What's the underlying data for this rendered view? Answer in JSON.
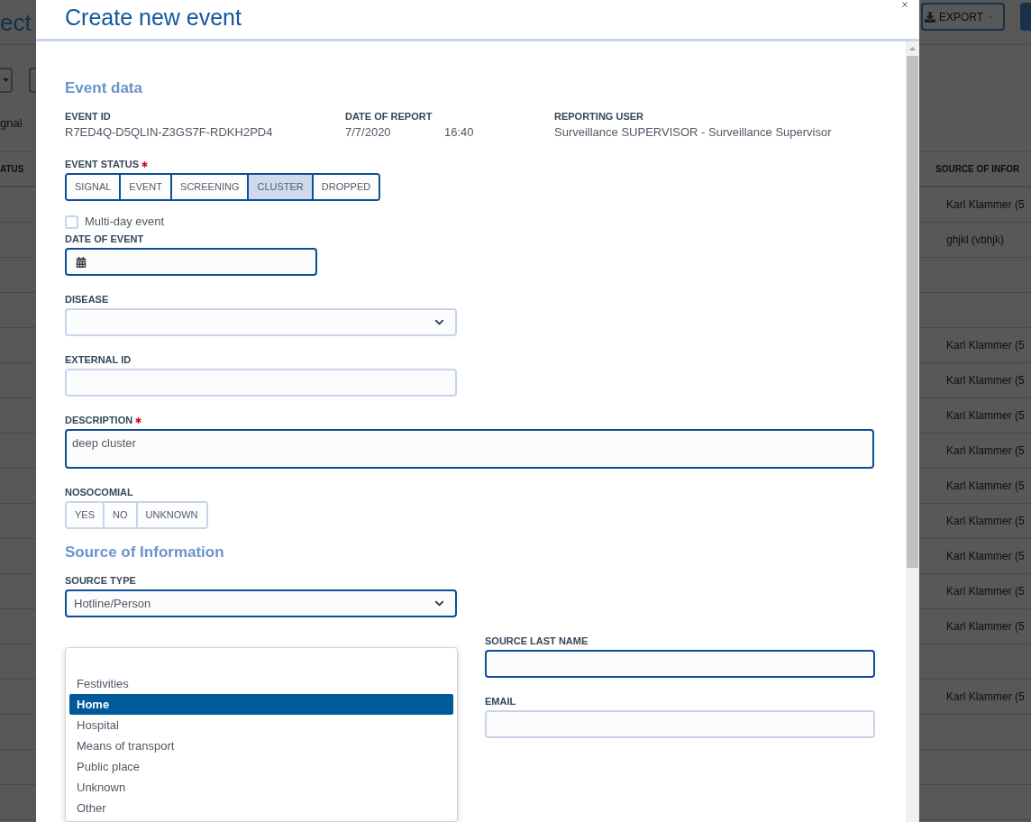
{
  "background": {
    "page_title": "ect",
    "export_button": "EXPORT",
    "tab": "gnal",
    "columns": [
      "ATUS",
      "SOURCE OF INFOR"
    ],
    "rows": [
      {
        "source": "Karl Klammer (5"
      },
      {
        "source": "ghjkl (vbhjk)"
      },
      {},
      {},
      {
        "source": "Karl Klammer (5"
      },
      {
        "source": "Karl Klammer (5"
      },
      {
        "source": "Karl Klammer (5"
      },
      {
        "source": "Karl Klammer (5"
      },
      {
        "source": "Karl Klammer (5"
      },
      {
        "source": "Karl Klammer (5"
      },
      {
        "source": "Karl Klammer (5"
      },
      {
        "source": "Karl Klammer (5"
      },
      {
        "source": "Karl Klammer (5"
      },
      {},
      {
        "source": "Karl Klammer (5"
      },
      {},
      {},
      {}
    ]
  },
  "dialog": {
    "title": "Create new event",
    "event_data": {
      "heading": "Event data",
      "info": [
        {
          "label": "EVENT ID",
          "values": [
            "R7ED4Q-D5QLIN-Z3GS7F-RDKH2PD4"
          ]
        },
        {
          "label": "DATE OF REPORT",
          "values": [
            "7/7/2020",
            "16:40"
          ]
        },
        {
          "label": "REPORTING USER",
          "values": [
            "Surveillance SUPERVISOR - Surveillance Supervisor"
          ]
        }
      ],
      "fields": [
        {
          "kind": "segmented",
          "label": "EVENT STATUS",
          "required": true,
          "highlighted": true,
          "options": [
            {
              "label": "SIGNAL",
              "selected": false
            },
            {
              "label": "EVENT",
              "selected": false
            },
            {
              "label": "SCREENING",
              "selected": false
            },
            {
              "label": "CLUSTER",
              "selected": true
            },
            {
              "label": "DROPPED",
              "selected": false
            }
          ]
        },
        {
          "kind": "checkbox",
          "label": "Multi-day event",
          "checked": false
        },
        {
          "kind": "date",
          "label": "DATE OF EVENT",
          "required": false,
          "highlighted": true
        },
        {
          "kind": "select",
          "label": "DISEASE",
          "required": false,
          "highlighted": false
        },
        {
          "kind": "text",
          "label": "EXTERNAL ID",
          "required": false,
          "highlighted": false
        },
        {
          "kind": "textarea",
          "label": "DESCRIPTION",
          "required": true,
          "highlighted": true,
          "value": "deep cluster"
        },
        {
          "kind": "segmented",
          "label": "NOSOCOMIAL",
          "required": false,
          "highlighted": false,
          "options": [
            {
              "label": "YES",
              "selected": false
            },
            {
              "label": "NO",
              "selected": false
            },
            {
              "label": "UNKNOWN",
              "selected": false
            }
          ]
        }
      ]
    },
    "source_of_information": {
      "heading": "Source of Information",
      "fields": [
        {
          "kind": "select",
          "label": "SOURCE TYPE",
          "required": false,
          "highlighted": true,
          "value": "Hotline/Person"
        }
      ],
      "right_column": [
        {
          "kind": "text",
          "label": "SOURCE LAST NAME",
          "required": false,
          "highlighted": true
        },
        {
          "kind": "text",
          "label": "EMAIL",
          "required": false,
          "highlighted": false
        }
      ]
    },
    "dropdown_menu": {
      "options": [
        {
          "label": "Festivities",
          "selected": false
        },
        {
          "label": "Home",
          "selected": true
        },
        {
          "label": "Hospital",
          "selected": false
        },
        {
          "label": "Means of transport",
          "selected": false
        },
        {
          "label": "Public place",
          "selected": false
        },
        {
          "label": "Unknown",
          "selected": false
        },
        {
          "label": "Other",
          "selected": false
        }
      ]
    }
  }
}
